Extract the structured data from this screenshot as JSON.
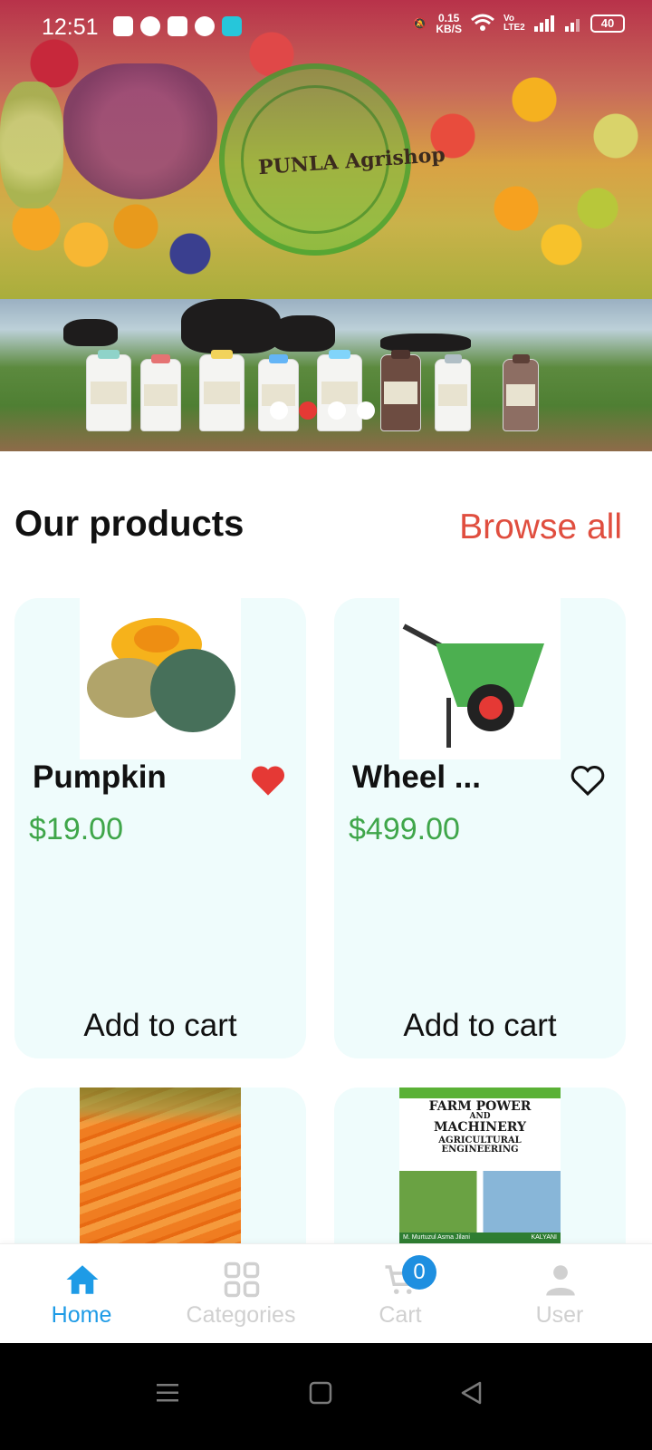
{
  "status_bar": {
    "time": "12:51",
    "net_speed_value": "0.15",
    "net_speed_unit": "KB/S",
    "volte": "Vo LTE2",
    "battery": "40"
  },
  "banner": {
    "logo_text": "PUNLA Agrishop",
    "slide_count": 4,
    "active_slide": 2
  },
  "section": {
    "title": "Our products",
    "browse_all": "Browse all"
  },
  "products": [
    {
      "name": "Pumpkin",
      "price": "$19.00",
      "favorite": true,
      "cart_label": "Add to cart",
      "image": "pumpkin"
    },
    {
      "name": "Wheel ...",
      "price": "$499.00",
      "favorite": false,
      "cart_label": "Add to cart",
      "image": "wheelbarrow"
    },
    {
      "name": "",
      "price": "",
      "image": "carrots"
    },
    {
      "name": "",
      "price": "",
      "image": "book-farm-power-and-machinery"
    }
  ],
  "book_cover": {
    "line1": "FARM POWER",
    "line2": "AND",
    "line3": "MACHINERY",
    "line4": "AGRICULTURAL ENGINEERING",
    "footer_left": "M. Murtuzul Asma Jilani",
    "footer_right": "KALYANI"
  },
  "bottom_nav": {
    "items": [
      {
        "label": "Home",
        "icon": "home-icon",
        "active": true
      },
      {
        "label": "Categories",
        "icon": "grid-icon",
        "active": false
      },
      {
        "label": "Cart",
        "icon": "cart-icon",
        "active": false,
        "badge": "0"
      },
      {
        "label": "User",
        "icon": "user-icon",
        "active": false
      }
    ]
  },
  "colors": {
    "accent_red": "#e04e3f",
    "price_green": "#3fa64a",
    "nav_active": "#1e9be6",
    "card_bg": "#effcfc"
  }
}
